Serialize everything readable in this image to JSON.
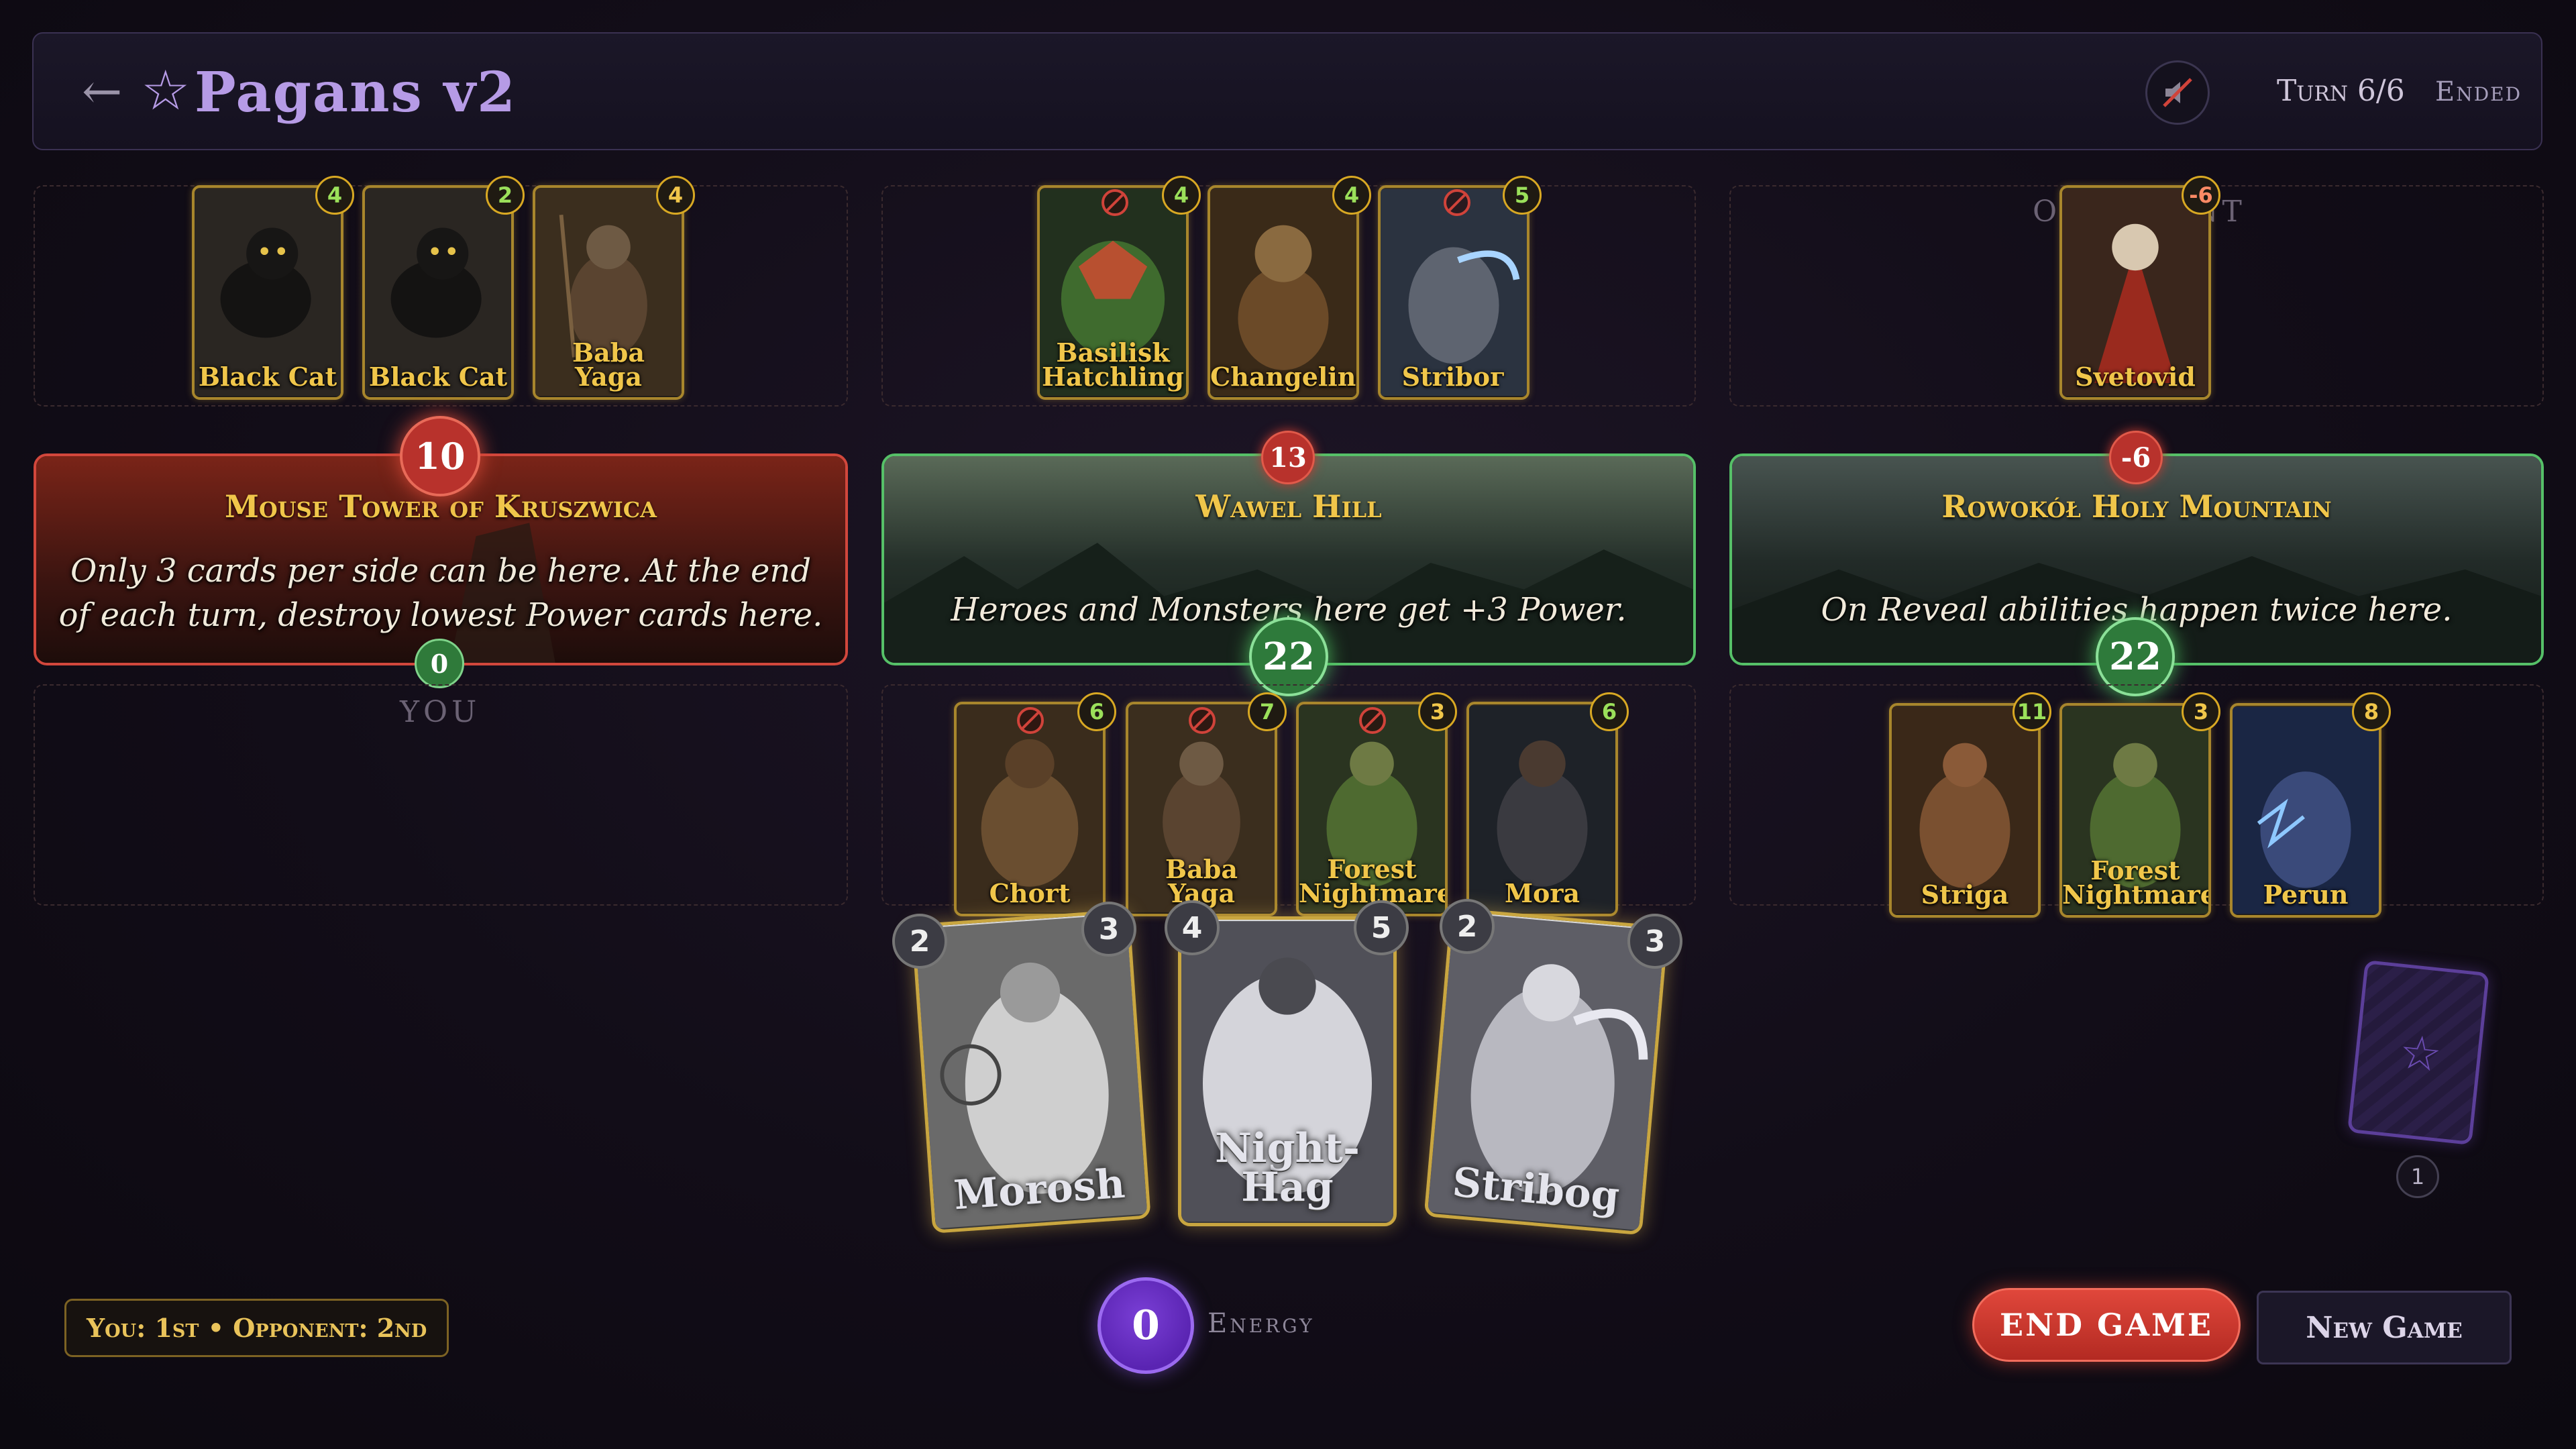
{
  "header": {
    "back_glyph": "←",
    "title_star": "☆",
    "title": "Pagans v2",
    "turn": "Turn 6/6",
    "status": "Ended",
    "sound_icon": "sound-muted-icon"
  },
  "labels": {
    "opponent": "OPPONENT",
    "you": "YOU"
  },
  "locations": [
    {
      "name": "Mouse Tower of Kruszwica",
      "description": "Only 3 cards per side can be here. At the end of each turn, destroy lowest Power cards here.",
      "opponent_power": "10",
      "my_power": "0",
      "color": "#c0392b",
      "opponent_cards": [
        {
          "name": "Black Cat",
          "power": "4"
        },
        {
          "name": "Black Cat",
          "power": "2"
        },
        {
          "name": "Baba Yaga",
          "power": "4"
        }
      ],
      "my_cards": []
    },
    {
      "name": "Wawel Hill",
      "description": "Heroes and Monsters here get +3 Power.",
      "opponent_power": "13",
      "my_power": "22",
      "color": "#3fae55",
      "opponent_cards": [
        {
          "name": "Basilisk Hatchling",
          "power": "4",
          "blocked": true
        },
        {
          "name": "Changeling",
          "power": "4"
        },
        {
          "name": "Striboг",
          "power": "5",
          "blocked": true
        }
      ],
      "my_cards": [
        {
          "name": "Chort",
          "power": "6",
          "blocked": true
        },
        {
          "name": "Baba Yaga",
          "power": "7",
          "blocked": true
        },
        {
          "name": "Forest Nightmare",
          "power": "3",
          "blocked": true
        },
        {
          "name": "Mora",
          "power": "6"
        }
      ]
    },
    {
      "name": "Rowokół Holy Mountain",
      "description": "On Reveal abilities happen twice here.",
      "opponent_power": "-6",
      "my_power": "22",
      "color": "#3fae55",
      "opponent_cards": [
        {
          "name": "Svetovid",
          "power": "-6"
        }
      ],
      "my_cards": [
        {
          "name": "Striga",
          "power": "11"
        },
        {
          "name": "Forest Nightmare",
          "power": "3"
        },
        {
          "name": "Perun",
          "power": "8"
        }
      ]
    }
  ],
  "hand": [
    {
      "name": "Morosh",
      "cost": "2",
      "power": "3"
    },
    {
      "name": "Night-Hag",
      "cost": "4",
      "power": "5"
    },
    {
      "name": "Stribog",
      "cost": "2",
      "power": "3"
    }
  ],
  "deck": {
    "count": "1",
    "icon": "star-icon"
  },
  "footer": {
    "order": "You: 1st • Opponent: 2nd",
    "energy": "0",
    "energy_label": "Energy",
    "end_game": "END GAME",
    "new_game": "New Game"
  }
}
